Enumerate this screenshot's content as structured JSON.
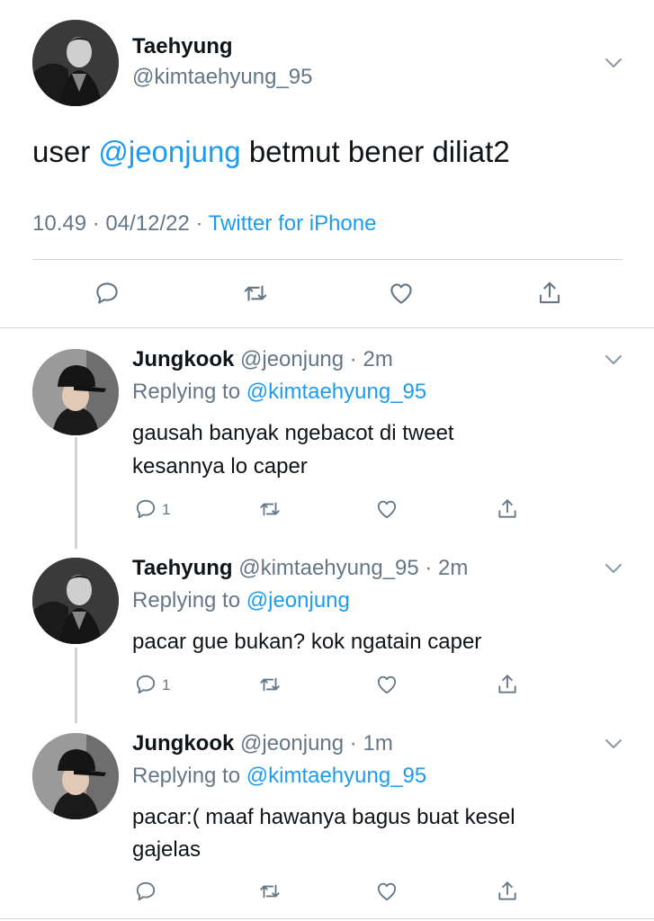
{
  "main_tweet": {
    "author_name": "Taehyung",
    "author_handle": "@kimtaehyung_95",
    "text_before": "user ",
    "mention": "@jeonjung",
    "text_after": " betmut bener diliat2",
    "time": "10.49",
    "sep1": " · ",
    "date": "04/12/22",
    "sep2": " · ",
    "client": "Twitter for iPhone",
    "avatar_icon": "avatar-taehyung",
    "actions": [
      "reply-icon",
      "retweet-icon",
      "like-icon",
      "share-icon"
    ]
  },
  "replies": [
    {
      "name": "Jungkook",
      "handle": "@jeonjung",
      "dot": " · ",
      "time": "2m",
      "replying_prefix": "Replying to ",
      "replying_to": "@kimtaehyung_95",
      "line1": "gausah banyak ngebacot di tweet",
      "line2": "kesannya lo caper",
      "reply_count": "1"
    },
    {
      "name": "Taehyung",
      "handle": "@kimtaehyung_95",
      "dot": " · ",
      "time": "2m",
      "replying_prefix": "Replying to ",
      "replying_to": "@jeonjung",
      "line1": "pacar gue bukan? kok ngatain caper",
      "reply_count": "1"
    },
    {
      "name": "Jungkook",
      "handle": "@jeonjung",
      "dot": " · ",
      "time": "1m",
      "replying_prefix": "Replying to ",
      "replying_to": "@kimtaehyung_95",
      "line1": "pacar:( maaf hawanya bagus buat kesel",
      "line2": "gajelas",
      "reply_count": ""
    }
  ],
  "colors": {
    "link": "#1d9bf0",
    "muted": "#657786",
    "divider": "#ccd6dd",
    "text": "#0f1419"
  }
}
